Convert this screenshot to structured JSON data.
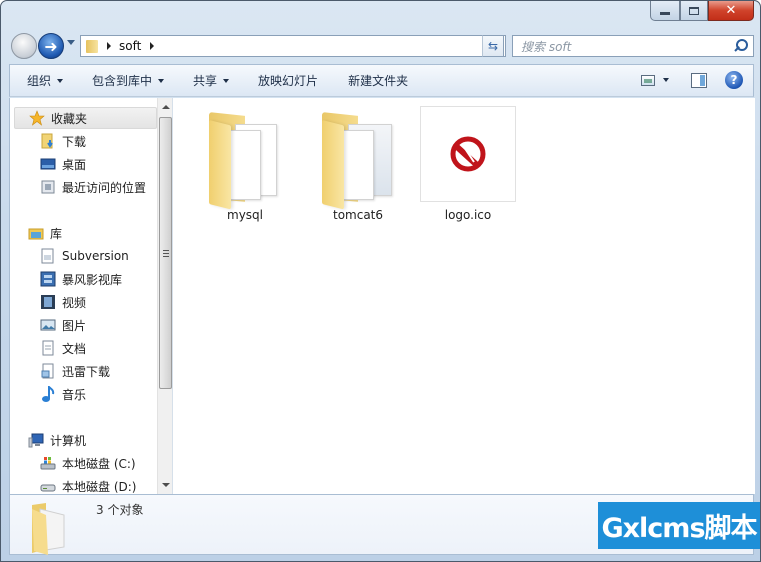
{
  "window": {
    "caption_buttons": {
      "minimize": "minimize",
      "maximize": "maximize",
      "close": "✕"
    }
  },
  "navbar": {
    "breadcrumb": [
      "soft"
    ],
    "refresh_glyph": "⇆",
    "search_placeholder": "搜索 soft"
  },
  "toolbar": {
    "items": [
      {
        "label": "组织",
        "has_dropdown": true
      },
      {
        "label": "包含到库中",
        "has_dropdown": true
      },
      {
        "label": "共享",
        "has_dropdown": true
      },
      {
        "label": "放映幻灯片",
        "has_dropdown": false
      },
      {
        "label": "新建文件夹",
        "has_dropdown": false
      }
    ],
    "help_glyph": "?"
  },
  "nav_pane": {
    "favorites": {
      "label": "收藏夹",
      "icon": "star-icon",
      "items": [
        {
          "label": "下载",
          "icon": "downloads-icon"
        },
        {
          "label": "桌面",
          "icon": "desktop-icon"
        },
        {
          "label": "最近访问的位置",
          "icon": "recent-places-icon"
        }
      ]
    },
    "libraries": {
      "label": "库",
      "icon": "libraries-icon",
      "items": [
        {
          "label": "Subversion",
          "icon": "library-document-icon"
        },
        {
          "label": "暴风影视库",
          "icon": "video-library-icon"
        },
        {
          "label": "视频",
          "icon": "videos-icon"
        },
        {
          "label": "图片",
          "icon": "pictures-icon"
        },
        {
          "label": "文档",
          "icon": "documents-icon"
        },
        {
          "label": "迅雷下载",
          "icon": "thunder-download-icon"
        },
        {
          "label": "音乐",
          "icon": "music-icon"
        }
      ]
    },
    "computer": {
      "label": "计算机",
      "icon": "computer-icon",
      "items": [
        {
          "label": "本地磁盘 (C:)",
          "icon": "system-drive-icon"
        },
        {
          "label": "本地磁盘 (D:)",
          "icon": "drive-icon"
        }
      ]
    }
  },
  "files": [
    {
      "name": "mysql",
      "type": "folder"
    },
    {
      "name": "tomcat6",
      "type": "folder"
    },
    {
      "name": "logo.ico",
      "type": "icon-file"
    }
  ],
  "details": {
    "summary": "3 个对象"
  },
  "watermark": {
    "text": "Gxlcms脚本"
  },
  "colors": {
    "accent": "#1e8fd8",
    "close_button": "#c22e18",
    "logo_red": "#c0141b"
  }
}
